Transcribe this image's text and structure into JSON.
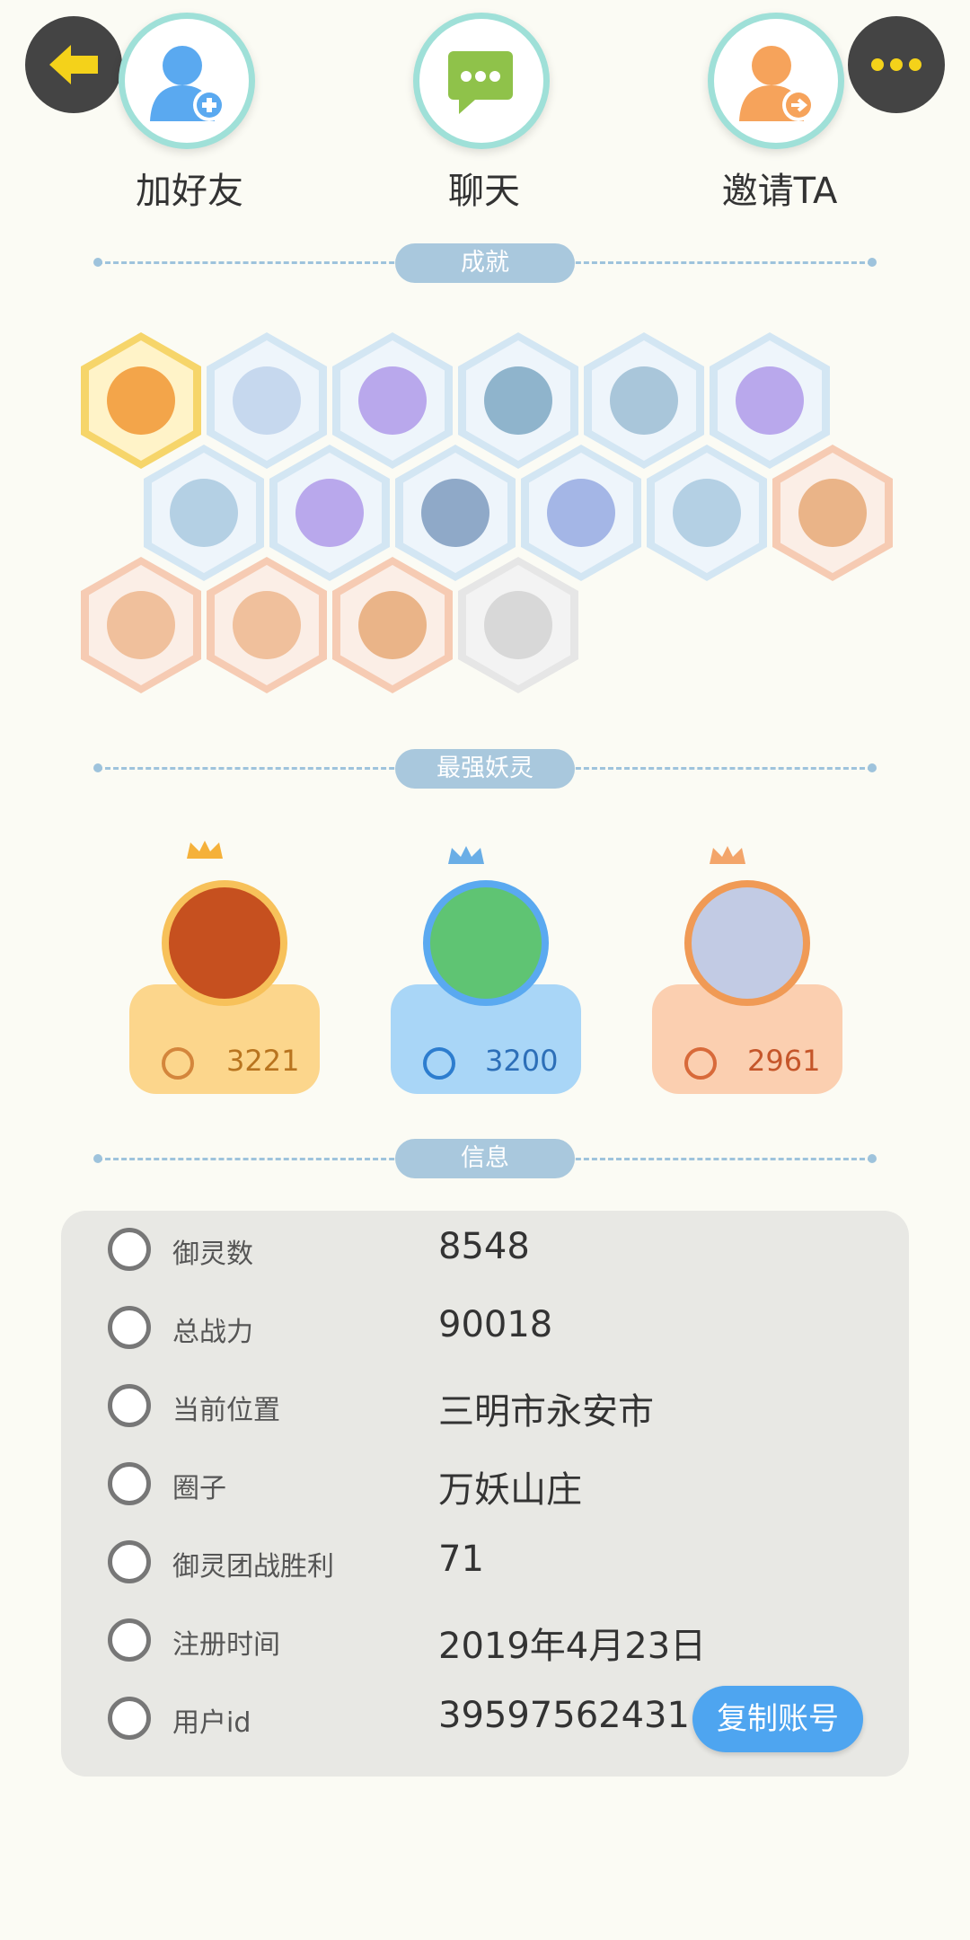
{
  "header": {
    "add_friend_label": "加好友",
    "chat_label": "聊天",
    "invite_label": "邀请TA"
  },
  "sections": {
    "achievements": "成就",
    "strongest": "最强妖灵",
    "info": "信息"
  },
  "strongest": [
    {
      "value": "3221",
      "theme": "#fcd68c"
    },
    {
      "value": "3200",
      "theme": "#a9d6f7"
    },
    {
      "value": "2961",
      "theme": "#fbcfb0"
    }
  ],
  "info": {
    "rows": [
      {
        "label": "御灵数",
        "value": "8548"
      },
      {
        "label": "总战力",
        "value": "90018"
      },
      {
        "label": "当前位置",
        "value": "三明市永安市"
      },
      {
        "label": "圈子",
        "value": "万妖山庄"
      },
      {
        "label": "御灵团战胜利",
        "value": "71"
      },
      {
        "label": "注册时间",
        "value": "2019年4月23日"
      },
      {
        "label": "用户id",
        "value": "39597562431"
      }
    ],
    "copy_button": "复制账号"
  },
  "colors": {
    "accent_blue": "#4ea5f0",
    "section_pill": "#a9c8dd",
    "background": "#fbfbf4"
  }
}
